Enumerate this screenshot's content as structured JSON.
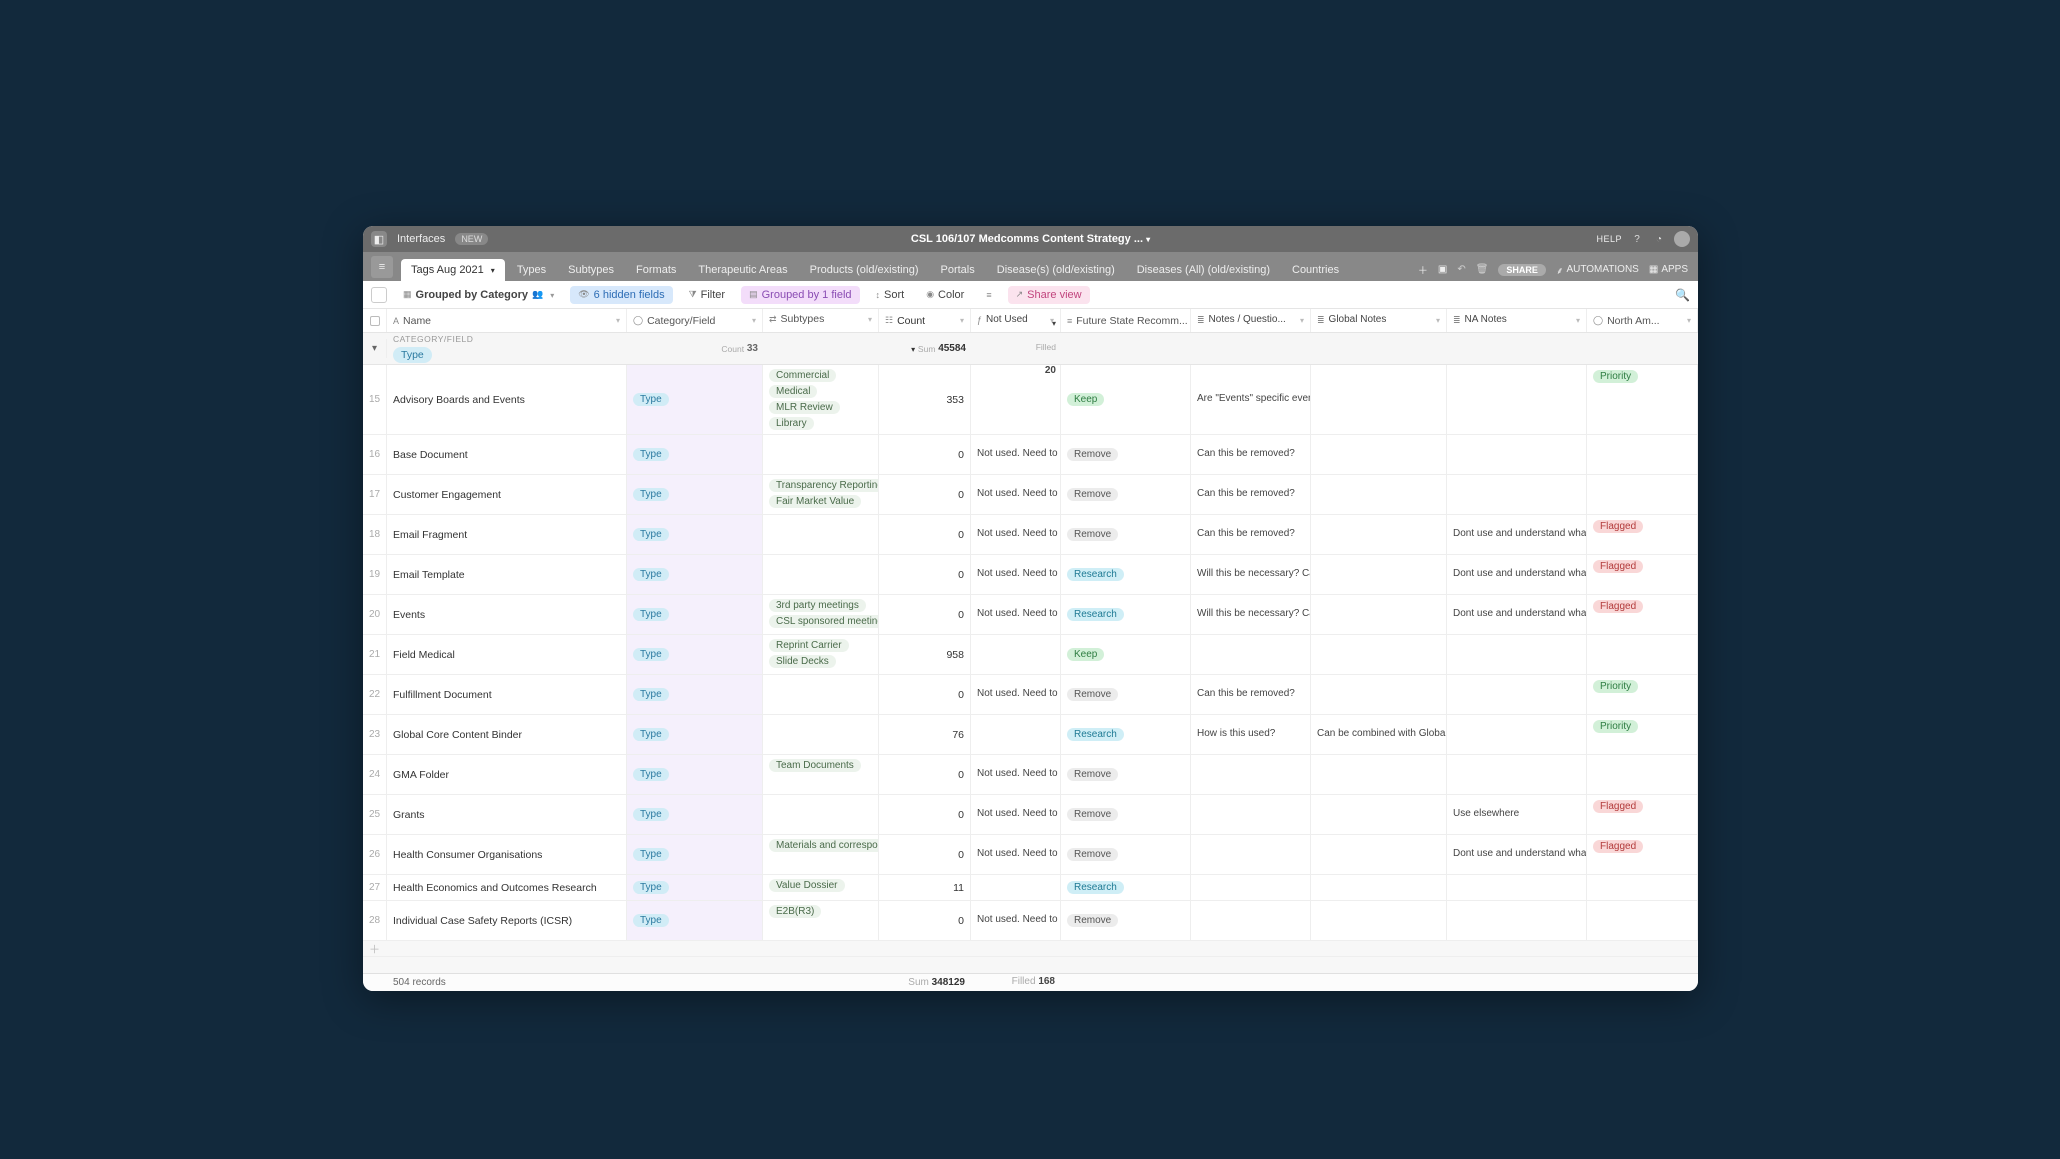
{
  "header": {
    "interfaces_label": "Interfaces",
    "new_badge": "NEW",
    "title": "CSL 106/107 Medcomms Content Strategy ...",
    "help_label": "HELP"
  },
  "table_tabs": {
    "active": "Tags Aug 2021",
    "tabs": [
      "Tags Aug 2021",
      "Types",
      "Subtypes",
      "Formats",
      "Therapeutic Areas",
      "Products (old/existing)",
      "Portals",
      "Disease(s) (old/existing)",
      "Diseases (All) (old/existing)",
      "Countries"
    ],
    "share_label": "SHARE",
    "automations_label": "AUTOMATIONS",
    "apps_label": "APPS"
  },
  "viewbar": {
    "view_name": "Grouped by Category",
    "hidden_fields": "6 hidden fields",
    "filter": "Filter",
    "grouped": "Grouped by 1 field",
    "sort": "Sort",
    "color": "Color",
    "share_view": "Share view"
  },
  "columns": [
    "Name",
    "Category/Field",
    "Subtypes",
    "Count",
    "Not Used",
    "Future State Recomm...",
    "Notes / Questio...",
    "Global Notes",
    "NA Notes",
    "North Am..."
  ],
  "group": {
    "label": "CATEGORY/FIELD",
    "value": "Type",
    "count_label": "Count",
    "count_value": "33",
    "sum_label": "Sum",
    "sum_value": "45584",
    "filled_label": "Filled",
    "filled_value": "20"
  },
  "rows": [
    {
      "n": "15",
      "name": "Advisory Boards and Events",
      "cat": "Type",
      "subs": [
        "Commercial",
        "Medical",
        "MLR Review",
        "Library"
      ],
      "count": "353",
      "nu": "",
      "fut": "Keep",
      "notes": "Are \"Events\" specific events having to do ...",
      "glob": "",
      "na": "",
      "north": "Priority",
      "tall": true
    },
    {
      "n": "16",
      "name": "Base Document",
      "cat": "Type",
      "subs": [],
      "count": "0",
      "nu": "Not used. Need to review.",
      "fut": "Remove",
      "notes": "Can this be removed?",
      "glob": "",
      "na": "",
      "north": "",
      "tall": true
    },
    {
      "n": "17",
      "name": "Customer Engagement",
      "cat": "Type",
      "subs": [
        "Transparency Reporting",
        "Fair Market Value"
      ],
      "count": "0",
      "nu": "Not used. Need to review.",
      "fut": "Remove",
      "notes": "Can this be removed?",
      "glob": "",
      "na": "",
      "north": "",
      "tall": true
    },
    {
      "n": "18",
      "name": "Email Fragment",
      "cat": "Type",
      "subs": [],
      "count": "0",
      "nu": "Not used. Need to review.",
      "fut": "Remove",
      "notes": "Can this be removed?",
      "glob": "",
      "na": "Dont use and understand what should be included i...",
      "north": "Flagged",
      "tall": true
    },
    {
      "n": "19",
      "name": "Email Template",
      "cat": "Type",
      "subs": [],
      "count": "0",
      "nu": "Not used. Need to review.",
      "fut": "Research",
      "notes": "Will this be necessary? Can it be removed?",
      "glob": "",
      "na": "Dont use and understand what should be included i...",
      "north": "Flagged",
      "tall": true
    },
    {
      "n": "20",
      "name": "Events",
      "cat": "Type",
      "subs": [
        "3rd party meetings",
        "CSL sponsored meeting"
      ],
      "count": "0",
      "nu": "Not used. Need to review.",
      "fut": "Research",
      "notes": "Will this be necessary? Can it be removed?",
      "glob": "",
      "na": "Dont use and understand what should be included i...",
      "north": "Flagged",
      "tall": true
    },
    {
      "n": "21",
      "name": "Field Medical",
      "cat": "Type",
      "subs": [
        "Reprint Carrier",
        "Slide Decks"
      ],
      "count": "958",
      "nu": "",
      "fut": "Keep",
      "notes": "",
      "glob": "",
      "na": "",
      "north": "",
      "tall": true
    },
    {
      "n": "22",
      "name": "Fulfillment Document",
      "cat": "Type",
      "subs": [],
      "count": "0",
      "nu": "Not used. Need to review.",
      "fut": "Remove",
      "notes": "Can this be removed?",
      "glob": "",
      "na": "",
      "north": "Priority",
      "tall": true
    },
    {
      "n": "23",
      "name": "Global Core Content Binder",
      "cat": "Type",
      "subs": [],
      "count": "76",
      "nu": "",
      "fut": "Research",
      "notes": "How is this used?",
      "glob": "Can be combined with Global Core Content Binde...",
      "na": "",
      "north": "Priority",
      "tall": true
    },
    {
      "n": "24",
      "name": "GMA Folder",
      "cat": "Type",
      "subs": [
        "Team Documents"
      ],
      "count": "0",
      "nu": "Not used. Need to review.",
      "fut": "Remove",
      "notes": "",
      "glob": "",
      "na": "",
      "north": "",
      "tall": true
    },
    {
      "n": "25",
      "name": "Grants",
      "cat": "Type",
      "subs": [],
      "count": "0",
      "nu": "Not used. Need to review.",
      "fut": "Remove",
      "notes": "",
      "glob": "",
      "na": "Use elsewhere",
      "north": "Flagged",
      "tall": true
    },
    {
      "n": "26",
      "name": "Health Consumer Organisations",
      "cat": "Type",
      "subs": [
        "Materials and correspo"
      ],
      "count": "0",
      "nu": "Not used. Need to review.",
      "fut": "Remove",
      "notes": "",
      "glob": "",
      "na": "Dont use and understand what should be includ",
      "north": "Flagged",
      "tall": true
    },
    {
      "n": "27",
      "name": "Health Economics and Outcomes Research",
      "cat": "Type",
      "subs": [
        "Value Dossier"
      ],
      "count": "11",
      "nu": "",
      "fut": "Research",
      "notes": "",
      "glob": "",
      "na": "",
      "north": "",
      "tall": false
    },
    {
      "n": "28",
      "name": "Individual Case Safety Reports (ICSR)",
      "cat": "Type",
      "subs": [
        "E2B(R3)"
      ],
      "count": "0",
      "nu": "Not used. Need to review.",
      "fut": "Remove",
      "notes": "",
      "glob": "",
      "na": "",
      "north": "",
      "tall": true
    }
  ],
  "summary": {
    "records": "504 records",
    "sum_label": "Sum",
    "sum_value": "348129",
    "filled_label": "Filled",
    "filled_value": "168"
  },
  "fut_chip_class": {
    "Keep": "chip-keep",
    "Remove": "chip-remove",
    "Research": "chip-research"
  },
  "north_chip_class": {
    "Priority": "chip-priority",
    "Flagged": "chip-flagged"
  }
}
